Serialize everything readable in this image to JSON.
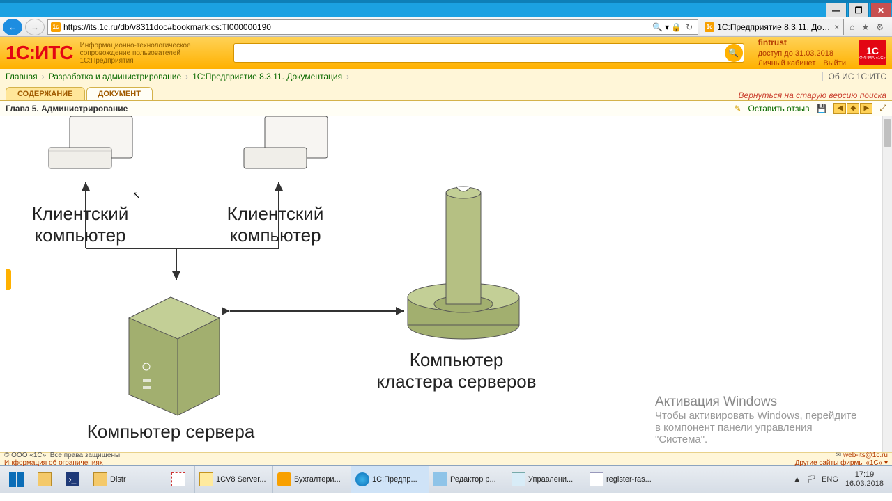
{
  "browser": {
    "url": "https://its.1c.ru/db/v8311doc#bookmark:cs:TI000000190",
    "tab_title": "1С:Предприятие 8.3.11. До…",
    "icons": {
      "home": "⌂",
      "star": "★",
      "gear": "⚙",
      "search": "🔍",
      "lock": "🔒",
      "refresh": "↻",
      "close": "×"
    }
  },
  "its": {
    "logo": "1С:ИТС",
    "tagline": "Информационно-технологическое сопровождение пользователей 1С:Предприятия",
    "user": "fintrust",
    "access": "доступ до 31.03.2018",
    "account_link": "Личный кабинет",
    "logout": "Выйти",
    "brand_small": "1С"
  },
  "crumbs": {
    "items": [
      "Главная",
      "Разработка и администрирование",
      "1С:Предприятие 8.3.11. Документация"
    ],
    "right": "Об ИС 1С:ИТС"
  },
  "doc_tabs": {
    "toc": "СОДЕРЖАНИЕ",
    "doc": "ДОКУМЕНТ",
    "old_version": "Вернуться на старую версию поиска"
  },
  "chapter": {
    "title": "Глава 5. Администрирование",
    "feedback": "Оставить отзыв"
  },
  "diagram": {
    "client1": "Клиентский\nкомпьютер",
    "client2": "Клиентский\nкомпьютер",
    "server": "Компьютер сервера",
    "cluster": "Компьютер\nкластера серверов"
  },
  "watermark": {
    "title": "Активация Windows",
    "sub": "Чтобы активировать Windows, перейдите в компонент панели управления \"Система\"."
  },
  "footer": {
    "copyright": "© ООО «1С». Все права защищены",
    "restrictions": "Информация об ограничениях",
    "email": "web-its@1c.ru",
    "other_sites": "Другие сайты фирмы «1С» ▾"
  },
  "taskbar": {
    "items": [
      {
        "label": "",
        "icon": "explorer"
      },
      {
        "label": "",
        "icon": "ps"
      },
      {
        "label": "Distr",
        "icon": "folder"
      },
      {
        "label": "",
        "icon": "snip"
      },
      {
        "label": "1CV8 Server...",
        "icon": "1c"
      },
      {
        "label": "Бухгалтери...",
        "icon": "1cy"
      },
      {
        "label": "1С:Предпр...",
        "icon": "ie"
      },
      {
        "label": "Редактор р...",
        "icon": "gear"
      },
      {
        "label": "Управлени...",
        "icon": "svc"
      },
      {
        "label": "register-ras...",
        "icon": "note"
      }
    ],
    "tray": {
      "flag": "▲",
      "lang": "ENG",
      "time": "17:19",
      "date": "16.03.2018"
    }
  }
}
